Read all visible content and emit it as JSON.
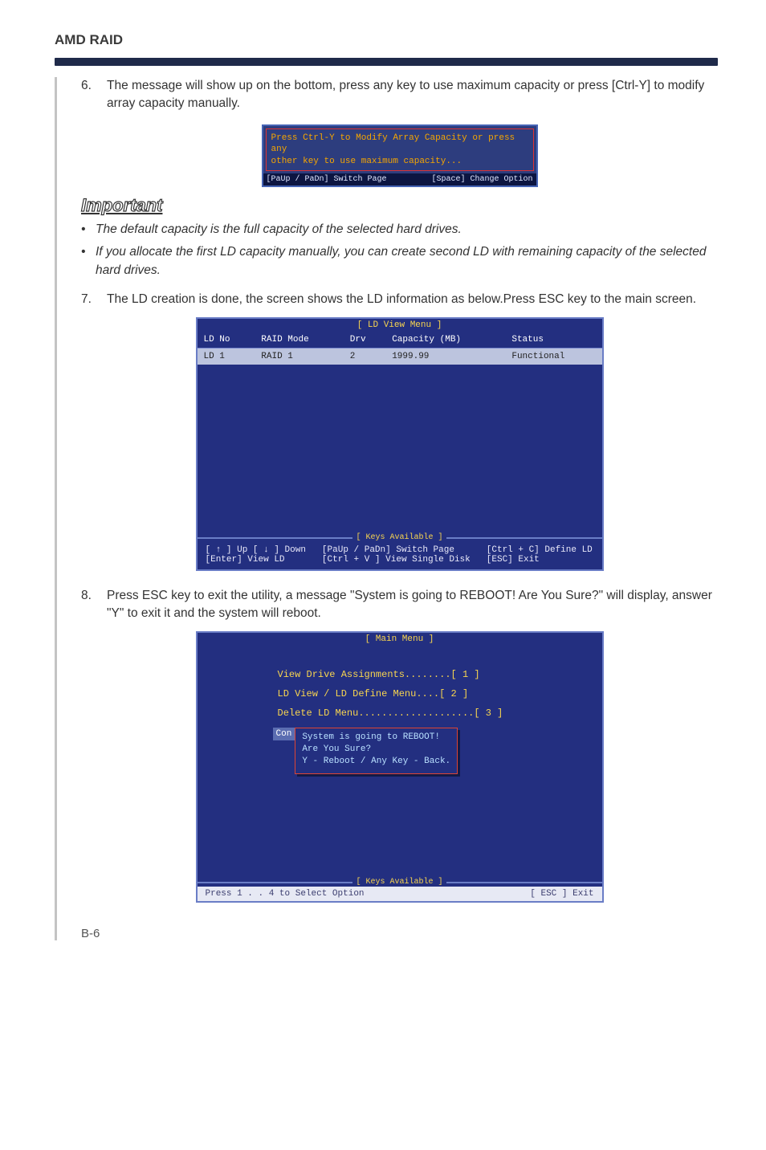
{
  "header": {
    "title": "AMD RAID"
  },
  "steps": {
    "s6": {
      "num": "6.",
      "text": "The message will show up on the bottom, press any key to use maximum capacity or press [Ctrl-Y] to modify array capacity manually."
    },
    "s7": {
      "num": "7.",
      "text": "The LD creation is done, the screen shows the LD information as below.Press ESC key to the main screen."
    },
    "s8": {
      "num": "8.",
      "text": "Press ESC key to exit the utility, a message \"System is going to REBOOT! Are You Sure?\" will display, answer \"Y\" to exit it and the system will reboot."
    }
  },
  "dialog1": {
    "line1": "Press Ctrl-Y to Modify Array Capacity or press any",
    "line2": "other key to use maximum capacity...",
    "footer_left": "[PaUp / PaDn]  Switch Page",
    "footer_right": "[Space]  Change Option"
  },
  "important": {
    "label": "Important",
    "b1": "The default capacity is the full capacity of the selected hard drives.",
    "b2": "If you allocate the first LD capacity manually, you can create second LD with remaining capacity of the selected hard drives."
  },
  "ldview": {
    "title": "[  LD View Menu  ]",
    "cols": {
      "c1": "LD No",
      "c2": "RAID Mode",
      "c3": "Drv",
      "c4": "Capacity (MB)",
      "c5": "Status"
    },
    "row": {
      "c1": "LD   1",
      "c2": "RAID 1",
      "c3": "2",
      "c4": "1999.99",
      "c5": "Functional"
    },
    "keys_title": "[ Keys Available ]",
    "k1": "[ ↑ ] Up    [ ↓ ] Down",
    "k2": "[PaUp / PaDn] Switch Page",
    "k3": "[Ctrl + C] Define LD",
    "k4": "[Enter] View LD",
    "k5": "[Ctrl + V ]  View Single Disk",
    "k6": "[ESC] Exit"
  },
  "mainmenu": {
    "title": "[  Main Menu  ]",
    "i1": "View Drive Assignments........[  1  ]",
    "i2": "LD View / LD Define Menu....[  2  ]",
    "i3": "Delete LD Menu....................[  3  ]",
    "con_label": "Con",
    "dlg1": "System is going to REBOOT!",
    "dlg2": "Are You Sure?",
    "dlg3": "Y - Reboot / Any Key - Back.",
    "keys_title": "[ Keys Available ]",
    "footer_left": "Press 1 . . 4 to Select Option",
    "footer_right": "[ ESC ]   Exit"
  },
  "page_num": "B-6"
}
